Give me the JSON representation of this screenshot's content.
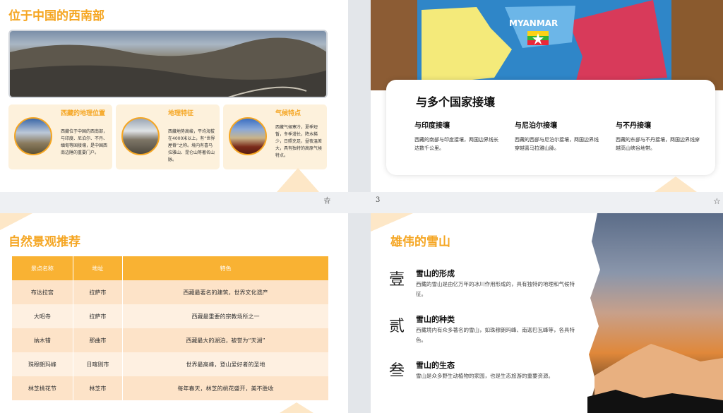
{
  "slide1": {
    "title": "位于中国的西南部",
    "cards": [
      {
        "title": "西藏的地理位置",
        "text": "西藏位于中国的西南部，与印度、尼泊尔、不丹、缅甸等国接壤，是中国西南边陲的重要门户。"
      },
      {
        "title": "地理特征",
        "text": "西藏地势高峻，平均海拔在4000米以上，有“世界屋脊”之称。境内有喜马拉雅山、昆仑山等著名山脉。"
      },
      {
        "title": "气候特点",
        "text": "西藏气候寒冷，夏季短暂，冬季漫长，降水稀少，日照充足，昼夜温差大，具有独特的高原气候特点。"
      }
    ]
  },
  "slide2": {
    "map_label": "MYANMAR",
    "title": "与多个国家接壤",
    "cols": [
      {
        "title": "与印度接壤",
        "text": "西藏的南部与印度接壤，两国边界线长达数千公里。"
      },
      {
        "title": "与尼泊尔接壤",
        "text": "西藏的西部与尼泊尔接壤，两国边界线穿越喜马拉雅山脉。"
      },
      {
        "title": "与不丹接壤",
        "text": "西藏的东部与不丹接壤，两国边界线穿越高山峡谷地带。"
      }
    ]
  },
  "page_number": "3",
  "slide3": {
    "title": "自然景观推荐",
    "headers": [
      "景点名称",
      "地址",
      "特色"
    ],
    "rows": [
      [
        "布达拉宫",
        "拉萨市",
        "西藏最著名的建筑，世界文化遗产"
      ],
      [
        "大昭寺",
        "拉萨市",
        "西藏最重要的宗教场所之一"
      ],
      [
        "纳木错",
        "那曲市",
        "西藏最大的湖泊，被誉为“天湖”"
      ],
      [
        "珠穆朗玛峰",
        "日喀则市",
        "世界最高峰，登山爱好者的圣地"
      ],
      [
        "林芝桃花节",
        "林芝市",
        "每年春天，林芝的桃花盛开，美不胜收"
      ]
    ]
  },
  "slide4": {
    "title": "雄伟的雪山",
    "items": [
      {
        "num": "壹",
        "title": "雪山的形成",
        "text": "西藏的雪山是由亿万年的冰川作用形成的，具有独特的地理和气候特征。"
      },
      {
        "num": "贰",
        "title": "雪山的种类",
        "text": "西藏境内有众多著名的雪山，如珠穆朗玛峰、南迦巴瓦峰等，各具特色。"
      },
      {
        "num": "叁",
        "title": "雪山的生态",
        "text": "雪山是众多野生动植物的家园，也是生态旅游的重要资源。"
      }
    ]
  },
  "colors": {
    "accent": "#f5a623",
    "table_header": "#f9b233"
  }
}
